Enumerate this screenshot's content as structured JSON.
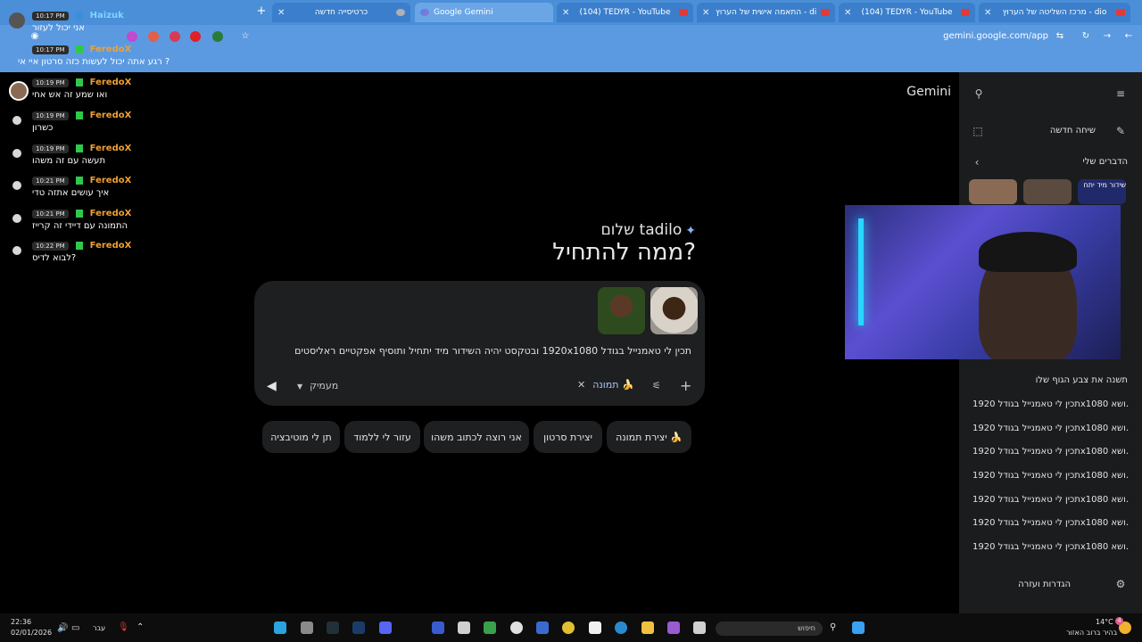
{
  "browser": {
    "tabs": [
      {
        "title": "כרטיסייה חדשה",
        "favicon": "blank-tab-icon"
      },
      {
        "title": "Google Gemini",
        "favicon": "gemini-icon"
      },
      {
        "title": "(104) TEDYR - YouTube",
        "favicon": "youtube-icon"
      },
      {
        "title": "התאמה אישית של הערוץ - dio",
        "favicon": "youtube-studio-icon"
      },
      {
        "title": "(104) TEDYR - YouTube",
        "favicon": "youtube-icon"
      },
      {
        "title": "מרכז השליטה של הערוץ - dio",
        "favicon": "youtube-studio-icon"
      }
    ],
    "url": "gemini.google.com/app"
  },
  "gemini": {
    "brand": "Gemini",
    "greeting": "שלום tadilo",
    "headline": "ממה להתחיל?",
    "prompt_text": "תכין לי טאמנייל  בגודל 1920x1080  ובטקסט יהיה השידור מיד יתחיל ותוסיף אפקטיים ראליסטים",
    "model_label": "מעמיק",
    "image_chip": "תמונה",
    "suggestions": [
      "יצירת תמונה",
      "יצירת סרטון",
      "אני רוצה לכתוב משהו",
      "עזור לי ללמוד",
      "תן לי מוטיבציה"
    ]
  },
  "sidebar": {
    "new_chat": "שיחה חדשה",
    "my_stuff": "הדברים שלי",
    "history": [
      "תשנה את צבע הגוף שלו",
      "תכין לי טאמנייל בגודל 1920x1080 ושא...",
      "תכין לי טאמנייל בגודל 1920x1080 ושא...",
      "תכין לי טאמנייל בגודל 1920x1080 ושא...",
      "תכין לי טאמנייל בגודל 1920x1080 ושא...",
      "תכין לי טאמנייל בגודל 1920x1080 ושא...",
      "תכין לי טאמנייל בגודל 1920x1080 ושא...",
      "תכין לי טאמנייל בגודל 1920x1080 ושא..."
    ],
    "settings": "הגדרות ועזרה",
    "thumb_caption": "שידור מיד יתח"
  },
  "chat": {
    "top_user": "Haizuk",
    "top_time": "10:17 PM",
    "top_text": "אני יכול לעזור",
    "messages": [
      {
        "time": "10:17 PM",
        "user": "FeredoX",
        "text": "? רגע אתה יכול לעשות כזה סרטון איי אי"
      },
      {
        "time": "10:19 PM",
        "user": "FeredoX",
        "text": "ואו שמע זה אש אחי"
      },
      {
        "time": "10:19 PM",
        "user": "FeredoX",
        "text": "כשרון"
      },
      {
        "time": "10:19 PM",
        "user": "FeredoX",
        "text": "תעשה עם זה משהו"
      },
      {
        "time": "10:21 PM",
        "user": "FeredoX",
        "text": "איך עושים אתזה טדי"
      },
      {
        "time": "10:21 PM",
        "user": "FeredoX",
        "text": "התמונה עם דיידי זה קרייז"
      },
      {
        "time": "10:22 PM",
        "user": "FeredoX",
        "text": "?לבוא לדיס"
      }
    ]
  },
  "taskbar": {
    "time": "22:36",
    "date": "02/01/2026",
    "lang": "עבר",
    "weather_temp": "14°C",
    "weather_desc": "בהיר ברוב האזור",
    "search_label": "חיפוש",
    "notif_count": "4"
  },
  "colors": {
    "accent": "#a8c7fa",
    "chat_user": "#f0a030",
    "tabbar": "#4a8fd8"
  }
}
